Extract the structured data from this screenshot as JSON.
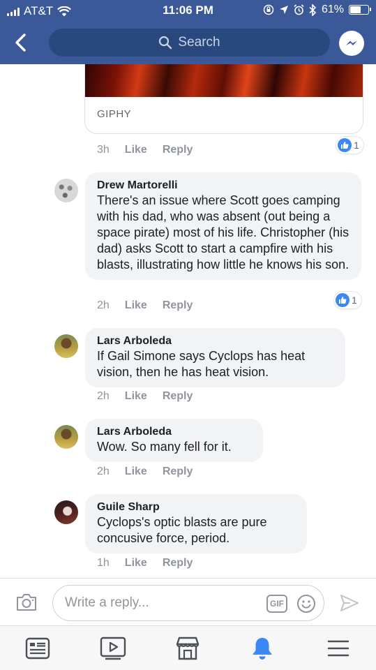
{
  "status_bar": {
    "carrier": "AT&T",
    "time": "11:06 PM",
    "battery_text": "61%",
    "battery_level": 0.61
  },
  "header": {
    "search_placeholder": "Search",
    "back_icon": "chevron-left-icon",
    "messenger_icon": "messenger-icon"
  },
  "gif_attachment": {
    "source_label": "GIPHY",
    "time": "3h",
    "like_label": "Like",
    "reply_label": "Reply",
    "reaction_count": "1"
  },
  "comments": [
    {
      "author": "Drew Martorelli",
      "text": "There's an issue where Scott goes camping with his dad, who was absent (out being a space pirate) most of his life. Christopher (his dad) asks Scott to start a campfire with his blasts, illustrating how little he knows his son.",
      "time": "2h",
      "like_label": "Like",
      "reply_label": "Reply",
      "reaction_count": "1"
    },
    {
      "author": "Lars Arboleda",
      "text": "If Gail Simone says Cyclops has heat vision, then he has heat vision.",
      "time": "2h",
      "like_label": "Like",
      "reply_label": "Reply"
    },
    {
      "author": "Lars Arboleda",
      "text": "Wow. So many fell for it.",
      "time": "2h",
      "like_label": "Like",
      "reply_label": "Reply"
    },
    {
      "author": "Guile Sharp",
      "text": "Cyclops's optic blasts are pure concusive force, period.",
      "time": "1h",
      "like_label": "Like",
      "reply_label": "Reply"
    }
  ],
  "composer": {
    "placeholder": "Write a reply...",
    "gif_label": "GIF"
  },
  "tabbar": {
    "items": [
      "news-feed-icon",
      "watch-icon",
      "marketplace-icon",
      "notifications-icon",
      "menu-icon"
    ],
    "active_index": 3,
    "active_color": "#3b88f5"
  },
  "colors": {
    "brand": "#3b5998",
    "like_blue": "#3b88f5"
  }
}
